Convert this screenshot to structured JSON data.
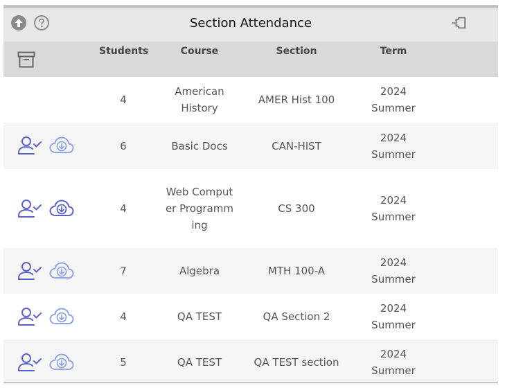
{
  "panel": {
    "title": "Section Attendance"
  },
  "icons": {
    "up": "up-arrow-icon",
    "help": "help-icon",
    "pin": "pin-icon",
    "archive": "archive-icon",
    "take_attendance": "user-check-icon",
    "download": "cloud-download-icon"
  },
  "columns": {
    "students": "Students",
    "course": "Course",
    "section": "Section",
    "term": "Term"
  },
  "rows": [
    {
      "students": "4",
      "course": "American History",
      "section": "AMER Hist 100",
      "term": "2024 Summer"
    },
    {
      "students": "6",
      "course": "Basic Docs",
      "section": "CAN-HIST",
      "term": "2024 Summer"
    },
    {
      "students": "4",
      "course": "Web Computer Programming",
      "section": "CS 300",
      "term": "2024 Summer"
    },
    {
      "students": "7",
      "course": "Algebra",
      "section": "MTH 100-A",
      "term": "2024 Summer"
    },
    {
      "students": "4",
      "course": "QA TEST",
      "section": "QA Section 2",
      "term": "2024 Summer"
    },
    {
      "students": "5",
      "course": "QA TEST",
      "section": "QA TEST section",
      "term": "2024 Summer"
    }
  ],
  "colors": {
    "icon_primary": "#5b63c9",
    "icon_secondary": "#8fa6e0",
    "header_bg": "#d9d9d9",
    "titlebar_bg": "#e8e8e8"
  }
}
